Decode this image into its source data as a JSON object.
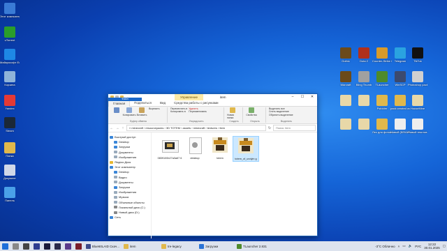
{
  "desktop_left": [
    {
      "label": "Этот компьютер",
      "icon": "computer-icon",
      "color": "#3a7bd5"
    },
    {
      "label": "uTorrent",
      "icon": "utorrent-icon",
      "color": "#2a9d2a"
    },
    {
      "label": "Майкрософт Edge",
      "icon": "edge-icon",
      "color": "#1e88e5"
    },
    {
      "label": "Корзина",
      "icon": "recycle-bin-icon",
      "color": "#8fb3d9"
    },
    {
      "label": "Yandex",
      "icon": "yandex-icon",
      "color": "#e53935"
    },
    {
      "label": "Steam",
      "icon": "steam-icon",
      "color": "#1b2838"
    },
    {
      "label": "Папка",
      "icon": "folder-icon",
      "color": "#e0b84c"
    },
    {
      "label": "Документ",
      "icon": "document-icon",
      "color": "#d0d8e8"
    },
    {
      "label": "Панель",
      "icon": "control-panel-icon",
      "color": "#4aa0e8"
    }
  ],
  "desktop_right_row1": [
    {
      "label": "Gothic",
      "icon": "warcraft-icon",
      "color": "#6b4a1a"
    },
    {
      "label": "Dota 2",
      "icon": "dota-icon",
      "color": "#b0301c"
    },
    {
      "label": "Counter-Strike Global Offensive",
      "icon": "csgo-icon",
      "color": "#d89a2a"
    },
    {
      "label": "Telegram",
      "icon": "telegram-icon",
      "color": "#2aa3e0"
    },
    {
      "label": "TikTok",
      "icon": "tiktok-icon",
      "color": "#111111"
    }
  ],
  "desktop_right_row2": [
    {
      "label": "Warcraft",
      "icon": "warcraft2-icon",
      "color": "#6b4a1a"
    },
    {
      "label": "Bling Thumb",
      "icon": "app-icon",
      "color": "#a0a0a0"
    },
    {
      "label": "TLauncher",
      "icon": "minecraft-icon",
      "color": "#4e8a2a"
    },
    {
      "label": "WinSCP",
      "icon": "winscp-icon",
      "color": "#3c4a6e"
    },
    {
      "label": "Photoshop pack",
      "icon": "photoshop-icon",
      "color": "#d0d0d0"
    }
  ],
  "desktop_right_row3": [
    {
      "label": "",
      "icon": "file-icon",
      "color": "#e8d8a8"
    },
    {
      "label": "",
      "icon": "file-icon",
      "color": "#e8d8a8"
    },
    {
      "label": "Psfolder",
      "icon": "folder-icon",
      "color": "#e0b84c"
    },
    {
      "label": "pack created worldhappy",
      "icon": "folder-icon",
      "color": "#e0b84c"
    },
    {
      "label": "HouseMine",
      "icon": "file-icon",
      "color": "#e8d8a8"
    }
  ],
  "desktop_right_row4": [
    {
      "label": "",
      "icon": "file-icon",
      "color": "#e8d8a8"
    },
    {
      "label": "",
      "icon": "file-icon",
      "color": "#e8d8a8"
    },
    {
      "label": "Лес для фотошопа",
      "icon": "folder-icon",
      "color": "#e0b84c"
    },
    {
      "label": "Новый (БЕКАП)",
      "icon": "file-icon",
      "color": "#eeeeee"
    },
    {
      "label": "Новый текстов...",
      "icon": "file-icon",
      "color": "#eeeeee"
    }
  ],
  "window": {
    "title": "item",
    "context_tab": "Управление",
    "tabs": [
      "Файл",
      "Главная",
      "Поделиться",
      "Вид",
      "Средства работы с рисунками"
    ],
    "ribbon": {
      "clipboard": {
        "pin": "Закрепить на панели быстрого доступа",
        "copy": "Копировать",
        "paste": "Вставить",
        "cut": "Вырезать",
        "copy_path": "Скопировать путь",
        "paste_shortcut": "Вставить ярлык",
        "name": "Буфер обмена"
      },
      "organize": {
        "move": "Переместить в",
        "copy_to": "Копировать в",
        "delete": "Удалить",
        "rename": "Переименовать",
        "name": "Упорядочить"
      },
      "new": {
        "folder": "Новая папка",
        "name": "Создать"
      },
      "open": {
        "props": "Свойства",
        "name": "Открыть"
      },
      "select": {
        "all": "Выделить все",
        "none": "Снять выделение",
        "invert": "Обратить выделение",
        "name": "Выделить"
      }
    },
    "path": "« minecraft › resourcepacks › 3D TOTEM › assets › minecraft › textures › item",
    "search_placeholder": "Поиск: item",
    "nav": [
      {
        "label": "Быстрый доступ",
        "color": "#3a86d8"
      },
      {
        "label": "Desktop",
        "color": "#3a86d8"
      },
      {
        "label": "Загрузки",
        "color": "#3a86d8"
      },
      {
        "label": "Документы",
        "color": "#9ab"
      },
      {
        "label": "Изображения",
        "color": "#9ab"
      },
      {
        "label": "",
        "color": "transparent"
      },
      {
        "label": "Яндекс.Диск",
        "color": "#e8b830"
      },
      {
        "label": "",
        "color": "transparent"
      },
      {
        "label": "Этот компьютер",
        "color": "#3a86d8"
      },
      {
        "label": "Desktop",
        "color": "#3a86d8"
      },
      {
        "label": "Видео",
        "color": "#9ab"
      },
      {
        "label": "Документы",
        "color": "#9ab"
      },
      {
        "label": "Загрузки",
        "color": "#3a86d8"
      },
      {
        "label": "Изображения",
        "color": "#9ab"
      },
      {
        "label": "Музыка",
        "color": "#9ab"
      },
      {
        "label": "Объемные объекты",
        "color": "#9ab"
      },
      {
        "label": "Локальный диск (C:)",
        "color": "#888"
      },
      {
        "label": "Новый диск (D:)",
        "color": "#888"
      },
      {
        "label": "",
        "color": "transparent"
      },
      {
        "label": "Сеть",
        "color": "#3a86d8"
      }
    ],
    "files": [
      {
        "name": "0839100b27a3a67 6",
        "kind": "image"
      },
      {
        "name": "desktop",
        "kind": "config"
      },
      {
        "name": "totem",
        "kind": "totem"
      },
      {
        "name": "totem_of_undyin g",
        "kind": "totem",
        "selected": true
      }
    ]
  },
  "taskbar": {
    "apps": [
      {
        "label": "Blue60LAID Скач...",
        "color": "#3c4a8a"
      },
      {
        "label": "item",
        "color": "#e0b84c"
      },
      {
        "label": "tre-legacy",
        "color": "#e0b84c"
      },
      {
        "label": "Загрузки",
        "color": "#2a73d6"
      },
      {
        "label": "TLauncher 2.831",
        "color": "#4e8a2a"
      }
    ],
    "weather": "-3°C Облачно",
    "lang": "РУС",
    "time": "12:22",
    "date": "30.01.2025"
  }
}
